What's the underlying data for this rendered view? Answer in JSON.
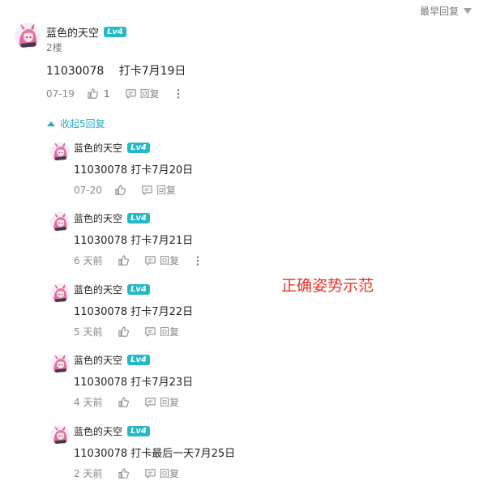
{
  "sort_label": "最早回复",
  "main_comment": {
    "username": "蓝色的天空",
    "level": "Lv4",
    "floor": "2楼",
    "text": "11030078　 打卡7月19日",
    "date": "07-19",
    "likes": "1",
    "reply_label": "回复"
  },
  "collapse_label": "收起5回复",
  "replies": [
    {
      "username": "蓝色的天空",
      "level": "Lv4",
      "text": "11030078 打卡7月20日",
      "date": "07-20",
      "reply_label": "回复"
    },
    {
      "username": "蓝色的天空",
      "level": "Lv4",
      "text": "11030078 打卡7月21日",
      "date": "6 天前",
      "reply_label": "回复"
    },
    {
      "username": "蓝色的天空",
      "level": "Lv4",
      "text": "11030078 打卡7月22日",
      "date": "5 天前",
      "reply_label": "回复"
    },
    {
      "username": "蓝色的天空",
      "level": "Lv4",
      "text": "11030078 打卡7月23日",
      "date": "4 天前",
      "reply_label": "回复"
    },
    {
      "username": "蓝色的天空",
      "level": "Lv4",
      "text": "11030078 打卡最后一天7月25日",
      "date": "2 天前",
      "reply_label": "回复"
    }
  ],
  "annotation": "正确姿势示范",
  "colors": {
    "accent": "#20aec2",
    "level_badge": "#23b9c7",
    "annotation": "#e8332a"
  }
}
